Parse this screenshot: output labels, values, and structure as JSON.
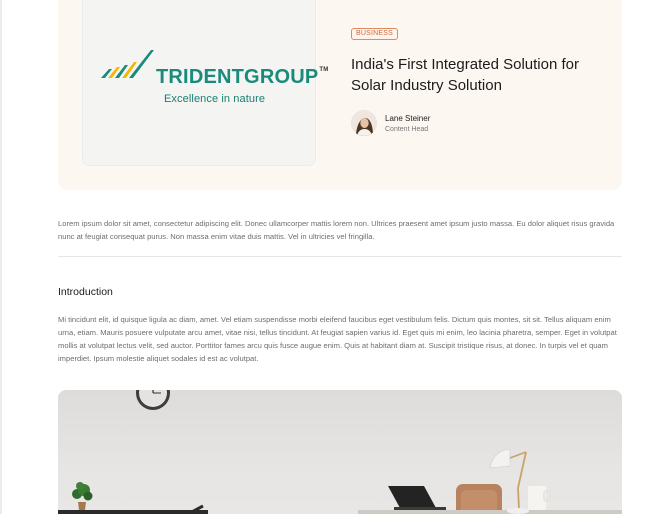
{
  "hero": {
    "logo": {
      "brand_text": "TRIDENTGROUP",
      "trademark": "TM",
      "tagline": "Excellence in nature"
    },
    "badge": "BUSINESS",
    "title": "India's First Integrated Solution for Solar Industry Solution",
    "author": {
      "name": "Lane Steiner",
      "role": "Content Head"
    }
  },
  "lead_paragraph": "Lorem ipsum dolor sit amet, consectetur adipiscing elit. Donec ullamcorper mattis lorem non. Ultrices praesent amet ipsum justo massa. Eu dolor aliquet risus gravida nunc at feugiat consequat purus. Non massa enim vitae duis mattis. Vel in ultricies vel fringilla.",
  "introduction": {
    "heading": "Introduction",
    "body": "Mi tincidunt elit, id quisque ligula ac diam, amet. Vel etiam suspendisse morbi eleifend faucibus eget vestibulum felis. Dictum quis montes, sit sit. Tellus aliquam enim urna, etiam. Mauris posuere vulputate arcu amet, vitae nisi, tellus tincidunt. At feugiat sapien varius id. Eget quis mi enim, leo lacinia pharetra, semper. Eget in volutpat mollis at volutpat lectus velit, sed auctor. Porttitor fames arcu quis fusce augue enim. Quis at habitant diam at. Suscipit tristique risus, at donec. In turpis vel et quam imperdiet. Ipsum molestie aliquet sodales id est ac volutpat."
  },
  "colors": {
    "hero_background": "#fdf7f1",
    "badge_accent": "#d06a37",
    "logo_teal": "#1a8a7a",
    "logo_yellow": "#f2b705"
  }
}
